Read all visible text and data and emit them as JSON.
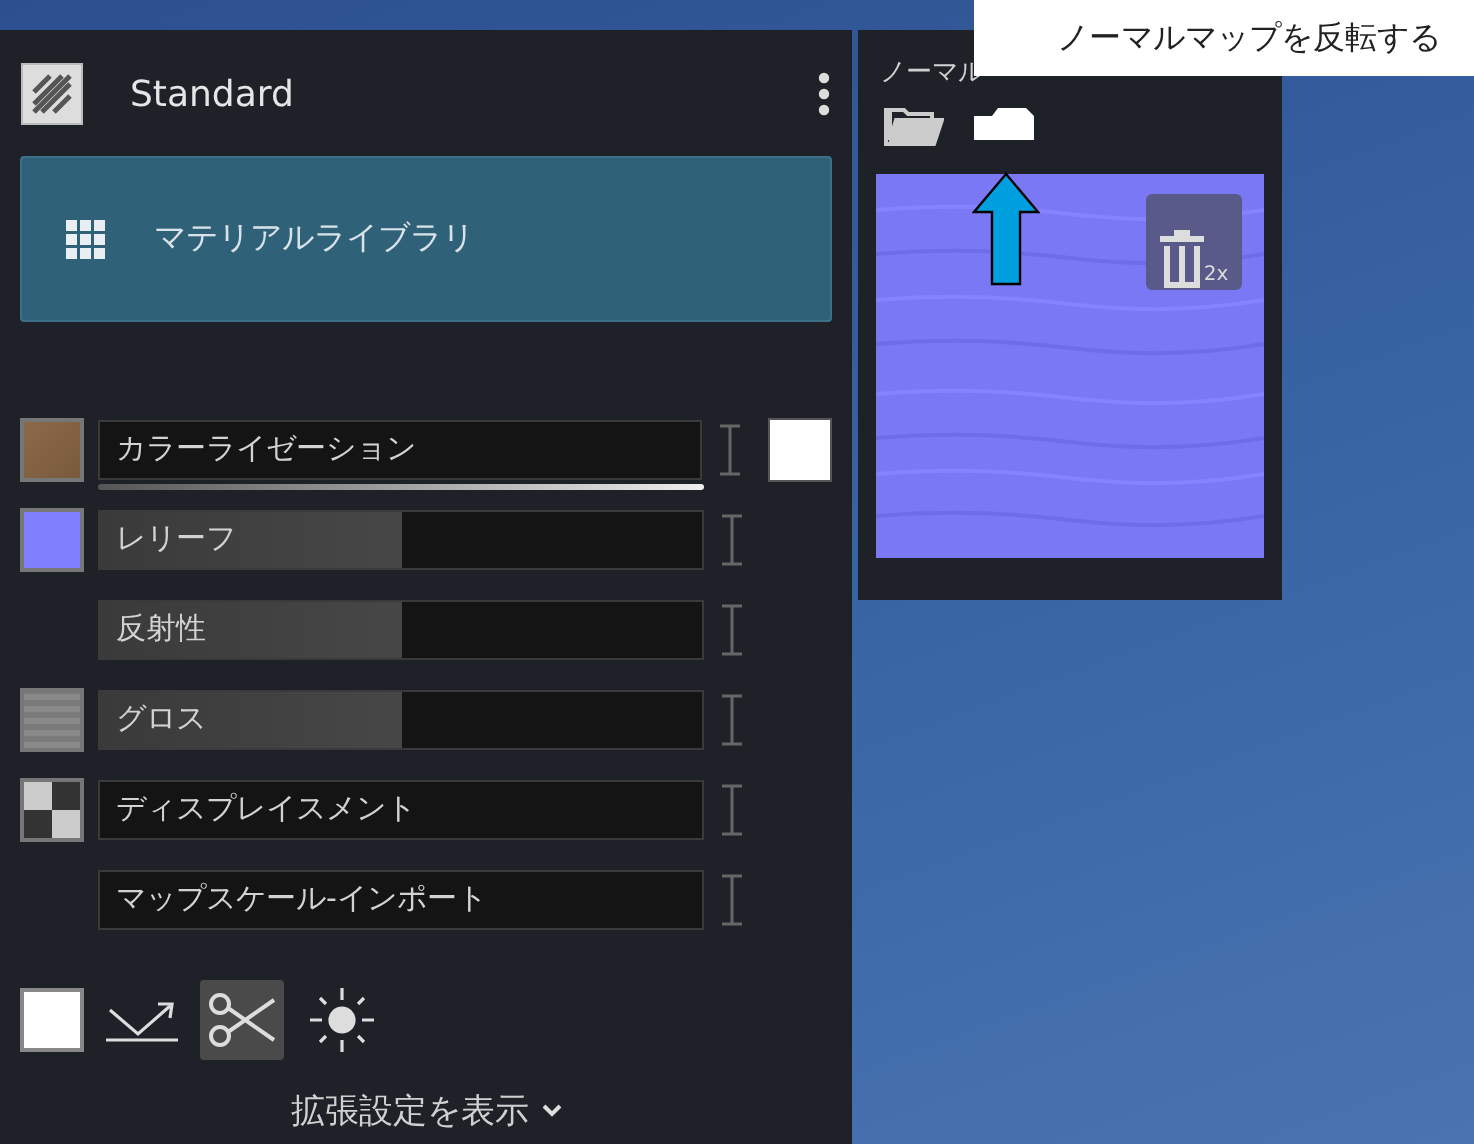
{
  "material": {
    "name": "Standard"
  },
  "library_button": {
    "label": "マテリアルライブラリ"
  },
  "channels": [
    {
      "label": "カラーライゼーション",
      "kind": "brown-texture",
      "extra_swatch": true,
      "underline": true
    },
    {
      "label": "レリーフ",
      "kind": "color",
      "color": "#8080ff",
      "level": 0.5
    },
    {
      "label": "反射性",
      "kind": "plain",
      "level": 0.5
    },
    {
      "label": "グロス",
      "kind": "gray-texture",
      "level": 0.5
    },
    {
      "label": "ディスプレイスメント",
      "kind": "checker"
    },
    {
      "label": "マップスケール-インポート",
      "kind": "plain"
    }
  ],
  "tools": [
    {
      "kind": "swatch",
      "selected": false
    },
    {
      "kind": "reflect",
      "selected": false
    },
    {
      "kind": "scissors",
      "selected": true
    },
    {
      "kind": "light",
      "selected": false
    }
  ],
  "advanced_link": "拡張設定を表示",
  "normal_map": {
    "title": "ノーマル",
    "delete_badge": "2x"
  },
  "tooltip": "ノーマルマップを反転する"
}
